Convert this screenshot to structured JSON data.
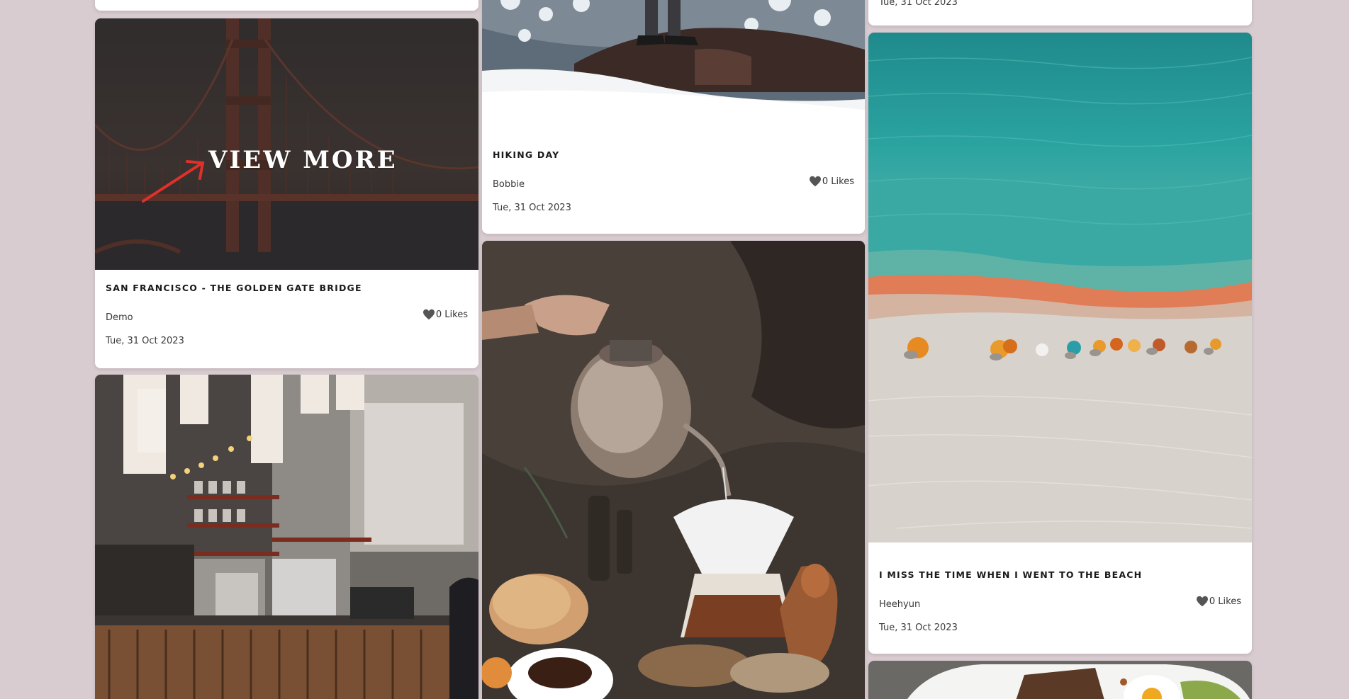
{
  "overlay": {
    "view_more": "VIEW MORE"
  },
  "col1": {
    "card_golden_gate": {
      "title": "SAN FRANCISCO - THE GOLDEN GATE BRIDGE",
      "author": "Demo",
      "likes": "0 Likes",
      "date": "Tue, 31 Oct 2023"
    }
  },
  "col2": {
    "card_hiking": {
      "title": "HIKING DAY",
      "author": "Bobbie",
      "likes": "0 Likes",
      "date": "Tue, 31 Oct 2023"
    }
  },
  "col3": {
    "top_date": "Tue, 31 Oct 2023",
    "card_beach": {
      "title": "I MISS THE TIME WHEN I WENT TO THE BEACH",
      "author": "Heehyun",
      "likes": "0 Likes",
      "date": "Tue, 31 Oct 2023"
    }
  },
  "icons": {
    "like": "heart-icon",
    "arrow": "arrow-icon"
  },
  "colors": {
    "page_bg": "#d9ccd1",
    "card_bg": "#ffffff",
    "accent_arrow": "#e0302a"
  }
}
